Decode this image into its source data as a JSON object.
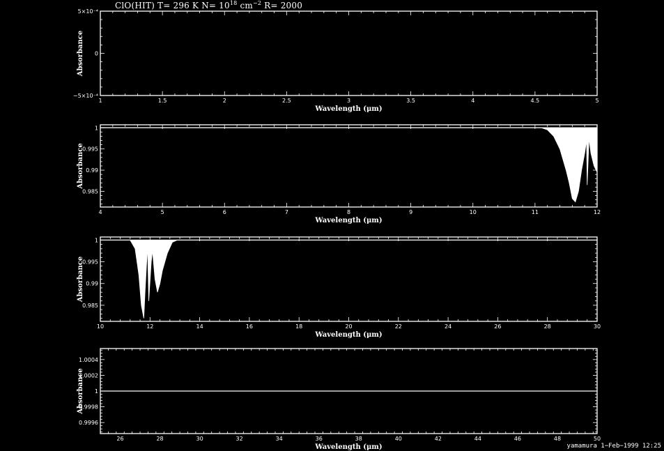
{
  "title": {
    "prefix": "ClO(HIT) T= 296 K N= 10",
    "n_exponent": "18",
    "unit": " cm",
    "unit_exponent": "−2",
    "suffix": " R= 2000"
  },
  "footer": "yamamura  1−Feb−1999 12:25",
  "chart_data": [
    {
      "type": "line",
      "xlabel": "Wavelength (μm)",
      "ylabel": "Absorbance",
      "xlim": [
        1,
        5
      ],
      "ylim": [
        -0.0005,
        0.0005
      ],
      "xticks": [
        {
          "v": 1,
          "label": "1"
        },
        {
          "v": 1.5,
          "label": "1.5"
        },
        {
          "v": 2,
          "label": "2"
        },
        {
          "v": 2.5,
          "label": "2.5"
        },
        {
          "v": 3,
          "label": "3"
        },
        {
          "v": 3.5,
          "label": "3.5"
        },
        {
          "v": 4,
          "label": "4"
        },
        {
          "v": 4.5,
          "label": "4.5"
        },
        {
          "v": 5,
          "label": "5"
        }
      ],
      "yticks": [
        {
          "v": 0.0005,
          "label": "5×10⁻⁴"
        },
        {
          "v": 0,
          "label": "0"
        },
        {
          "v": -0.0005,
          "label": "−5×10⁻⁴"
        }
      ],
      "series": [
        {
          "x": [],
          "y": []
        }
      ]
    },
    {
      "type": "area",
      "xlabel": "Wavelength (μm)",
      "ylabel": "Absorbance",
      "xlim": [
        4,
        12
      ],
      "ylim": [
        0.9813,
        1.0007
      ],
      "baseline": 1,
      "xticks": [
        {
          "v": 4,
          "label": "4"
        },
        {
          "v": 5,
          "label": "5"
        },
        {
          "v": 6,
          "label": "6"
        },
        {
          "v": 7,
          "label": "7"
        },
        {
          "v": 8,
          "label": "8"
        },
        {
          "v": 9,
          "label": "9"
        },
        {
          "v": 10,
          "label": "10"
        },
        {
          "v": 11,
          "label": "11"
        },
        {
          "v": 12,
          "label": "12"
        }
      ],
      "yticks": [
        {
          "v": 1,
          "label": "1"
        },
        {
          "v": 0.995,
          "label": "0.995"
        },
        {
          "v": 0.99,
          "label": "0.99"
        },
        {
          "v": 0.985,
          "label": "0.985"
        }
      ],
      "series": [
        {
          "x": [
            4,
            11.1,
            11.2,
            11.3,
            11.4,
            11.5,
            11.55,
            11.6,
            11.65,
            11.7,
            11.75,
            11.8,
            11.83,
            11.84,
            11.87,
            11.9,
            11.95,
            12
          ],
          "y": [
            1,
            1,
            0.9995,
            0.998,
            0.995,
            0.99,
            0.987,
            0.9833,
            0.9825,
            0.985,
            0.99,
            0.994,
            0.997,
            0.9865,
            0.9975,
            0.994,
            0.991,
            0.9895
          ]
        }
      ]
    },
    {
      "type": "area",
      "xlabel": "Wavelength (μm)",
      "ylabel": "Absorbance",
      "xlim": [
        10,
        30
      ],
      "ylim": [
        0.9813,
        1.0007
      ],
      "baseline": 1,
      "xticks": [
        {
          "v": 10,
          "label": "10"
        },
        {
          "v": 12,
          "label": "12"
        },
        {
          "v": 14,
          "label": "14"
        },
        {
          "v": 16,
          "label": "16"
        },
        {
          "v": 18,
          "label": "18"
        },
        {
          "v": 20,
          "label": "20"
        },
        {
          "v": 22,
          "label": "22"
        },
        {
          "v": 24,
          "label": "24"
        },
        {
          "v": 26,
          "label": "26"
        },
        {
          "v": 28,
          "label": "28"
        },
        {
          "v": 30,
          "label": "30"
        }
      ],
      "yticks": [
        {
          "v": 1,
          "label": "1"
        },
        {
          "v": 0.995,
          "label": "0.995"
        },
        {
          "v": 0.99,
          "label": "0.99"
        },
        {
          "v": 0.985,
          "label": "0.985"
        }
      ],
      "series": [
        {
          "x": [
            10,
            11.2,
            11.4,
            11.55,
            11.65,
            11.75,
            11.8,
            11.9,
            11.95,
            12.05,
            12.1,
            12.2,
            12.3,
            12.4,
            12.5,
            12.7,
            12.9,
            13.1
          ],
          "y": [
            1,
            1,
            0.998,
            0.992,
            0.985,
            0.982,
            0.988,
            0.9985,
            0.986,
            0.995,
            0.9975,
            0.991,
            0.988,
            0.99,
            0.993,
            0.997,
            0.9995,
            1
          ]
        }
      ]
    },
    {
      "type": "line",
      "xlabel": "Wavelength (μm)",
      "ylabel": "Absorbance",
      "xlim": [
        25,
        50
      ],
      "ylim": [
        0.99946,
        1.00054
      ],
      "xticks": [
        {
          "v": 26,
          "label": "26"
        },
        {
          "v": 28,
          "label": "28"
        },
        {
          "v": 30,
          "label": "30"
        },
        {
          "v": 32,
          "label": "32"
        },
        {
          "v": 34,
          "label": "34"
        },
        {
          "v": 36,
          "label": "36"
        },
        {
          "v": 38,
          "label": "38"
        },
        {
          "v": 40,
          "label": "40"
        },
        {
          "v": 42,
          "label": "42"
        },
        {
          "v": 44,
          "label": "44"
        },
        {
          "v": 46,
          "label": "46"
        },
        {
          "v": 48,
          "label": "48"
        },
        {
          "v": 50,
          "label": "50"
        }
      ],
      "yticks": [
        {
          "v": 1.0004,
          "label": "1.0004"
        },
        {
          "v": 1.0002,
          "label": "1.0002"
        },
        {
          "v": 1,
          "label": "1"
        },
        {
          "v": 0.9998,
          "label": "0.9998"
        },
        {
          "v": 0.9996,
          "label": "0.9996"
        }
      ],
      "series": [
        {
          "x": [
            25,
            50
          ],
          "y": [
            1,
            1
          ]
        }
      ]
    }
  ]
}
